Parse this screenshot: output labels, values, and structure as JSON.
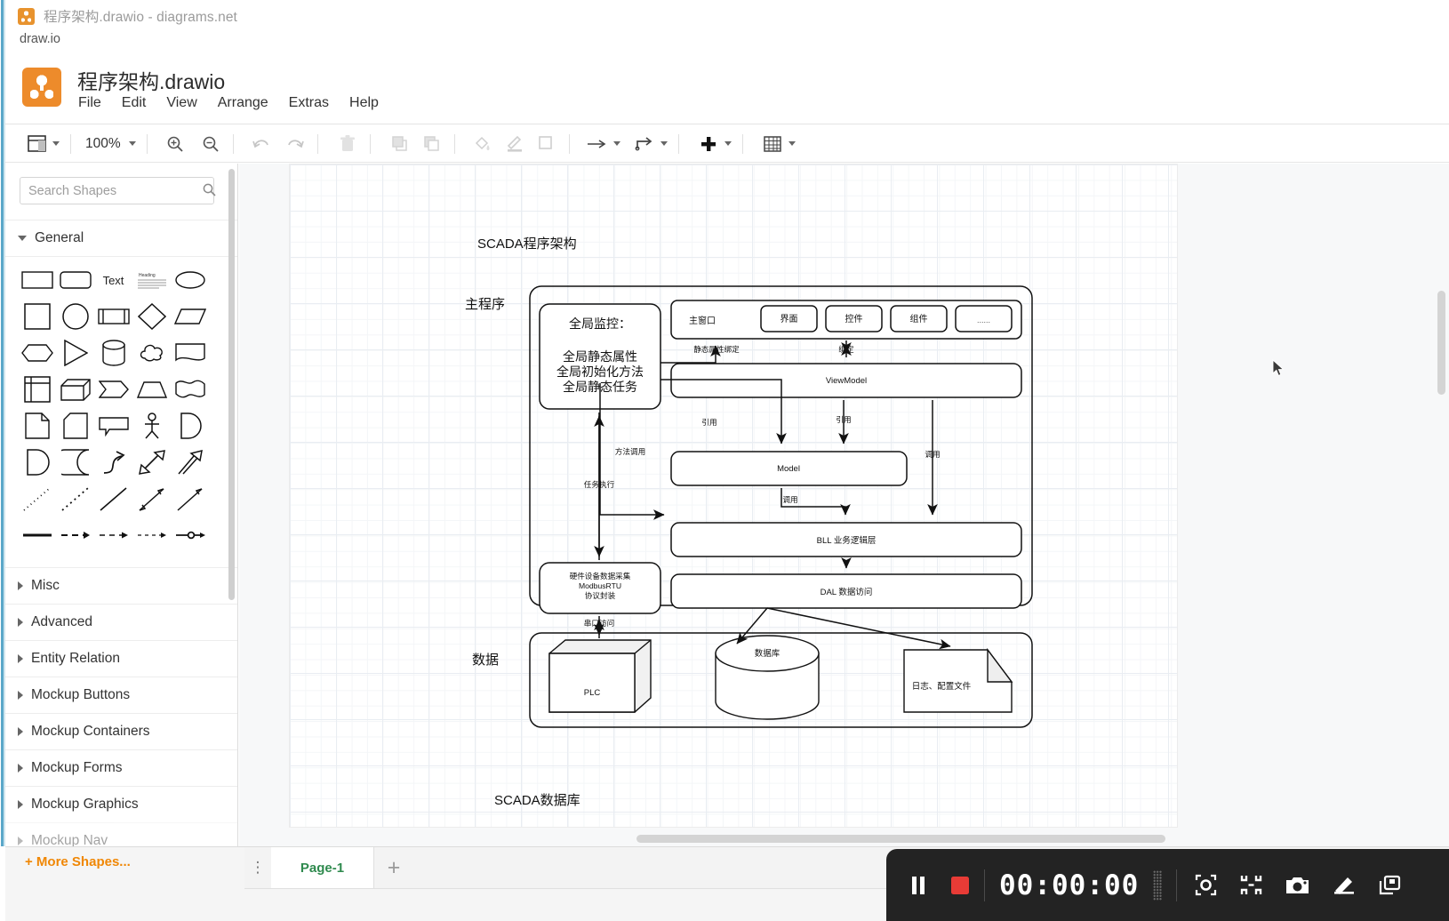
{
  "window": {
    "title": "程序架构.drawio - diagrams.net",
    "icon": "drawio-app-icon",
    "url_label": "draw.io"
  },
  "header": {
    "logo_icon": "drawio-logo-icon",
    "document_title": "程序架构.drawio",
    "menu": [
      "File",
      "Edit",
      "View",
      "Arrange",
      "Extras",
      "Help"
    ]
  },
  "toolbar": {
    "view_label": "view-icon",
    "zoom_level": "100%",
    "buttons": [
      "zoom-in-icon",
      "zoom-out-icon",
      "undo-icon",
      "redo-icon",
      "delete-icon",
      "to-front-icon",
      "to-back-icon",
      "fill-color-icon",
      "line-color-icon",
      "shadow-icon",
      "waypoints-icon",
      "edge-style-icon",
      "insert-icon",
      "table-icon"
    ]
  },
  "sidebar": {
    "search": {
      "placeholder": "Search Shapes",
      "value": "",
      "icon": "search-icon"
    },
    "sections": [
      {
        "label": "General",
        "expanded": true
      },
      {
        "label": "Misc",
        "expanded": false
      },
      {
        "label": "Advanced",
        "expanded": false
      },
      {
        "label": "Entity Relation",
        "expanded": false
      },
      {
        "label": "Mockup Buttons",
        "expanded": false
      },
      {
        "label": "Mockup Containers",
        "expanded": false
      },
      {
        "label": "Mockup Forms",
        "expanded": false
      },
      {
        "label": "Mockup Graphics",
        "expanded": false
      }
    ],
    "shape_text_label": "Text",
    "shape_heading_label": "Heading",
    "more_shapes": "+ More Shapes..."
  },
  "footer": {
    "pages": [
      {
        "label": "Page-1",
        "active": true
      }
    ],
    "add_page_icon": "plus-icon",
    "menu_icon": "kebab-menu-icon"
  },
  "recorder": {
    "pause_icon": "pause-icon",
    "stop_icon": "stop-record-icon",
    "timer": "00:00:00",
    "tools": [
      "target-capture-icon",
      "shrink-icon",
      "camera-icon",
      "pen-icon",
      "window-icon"
    ],
    "accent_color": "#e83b36",
    "background_color": "#232323"
  },
  "diagram": {
    "labels": {
      "title": "SCADA程序架构",
      "main_program": "主程序",
      "data": "数据",
      "bottom_title": "SCADA数据库"
    },
    "nodes": {
      "global_monitor": "全局监控：\n\n全局静态属性\n全局初始化方法\n全局静态任务",
      "main_window": "主窗口",
      "ui": "界面",
      "control": "控件",
      "component": "组件",
      "etc": "......",
      "viewmodel": "ViewModel",
      "model": "Model",
      "bll": "BLL  业务逻辑层",
      "dal": "DAL  数据访问",
      "hardware": "硬件设备数据采集\nModbusRTU\n协议封装",
      "plc": "PLC",
      "database": "数据库",
      "logfile": "日志、配置文件"
    },
    "edges": [
      {
        "label": "静态属性绑定",
        "from": "global_monitor",
        "to": "main_window"
      },
      {
        "label": "绑定",
        "from": "main_window",
        "to": "viewmodel"
      },
      {
        "label": "引用",
        "from": "global_monitor",
        "to": "model"
      },
      {
        "label": "引用",
        "from": "viewmodel",
        "to": "model"
      },
      {
        "label": "调用",
        "from": "viewmodel",
        "to": "bll"
      },
      {
        "label": "调用",
        "from": "model",
        "to": "bll"
      },
      {
        "label": "方法调用",
        "from": "global_monitor",
        "to": "bll"
      },
      {
        "label": "任务执行",
        "from": "global_monitor",
        "to": "hardware"
      },
      {
        "label": "",
        "from": "bll",
        "to": "dal"
      },
      {
        "label": "串口访问",
        "from": "hardware",
        "to": "plc"
      },
      {
        "label": "",
        "from": "dal",
        "to": "database"
      },
      {
        "label": "",
        "from": "dal",
        "to": "logfile"
      }
    ]
  }
}
